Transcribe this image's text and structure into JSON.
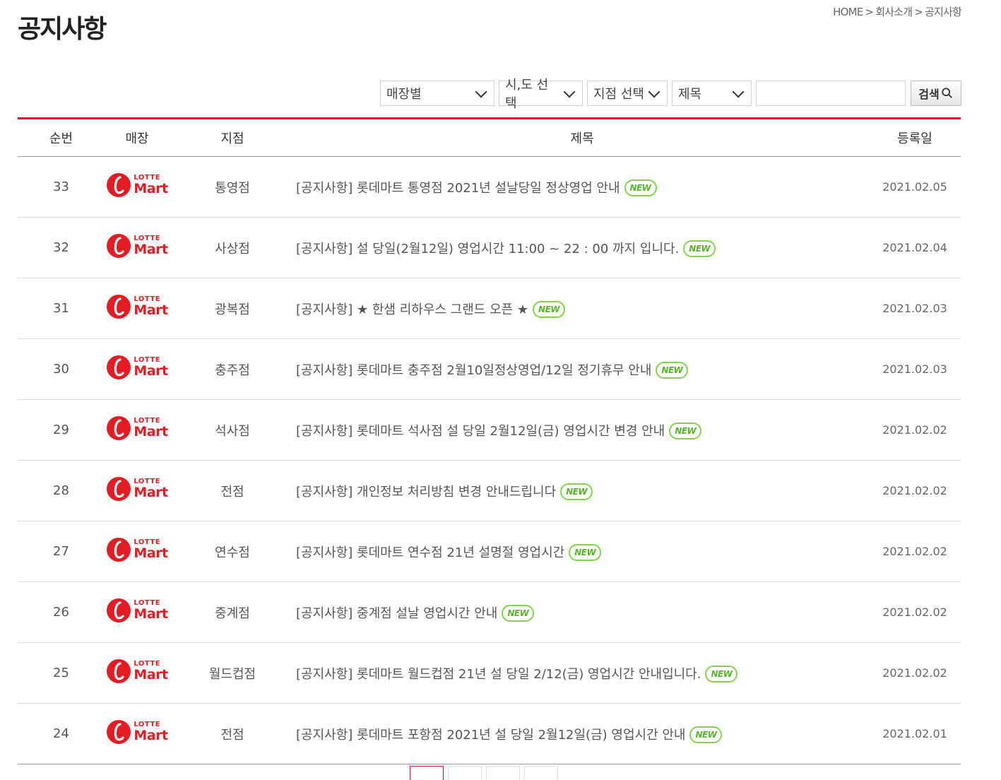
{
  "page": {
    "title": "공지사항",
    "breadcrumb": [
      "HOME",
      "회사소개",
      "공지사항"
    ],
    "breadcrumb_sep": ">"
  },
  "search": {
    "store_type": "매장별",
    "region": "시,도 선택",
    "branch": "지점 선택",
    "field": "제목",
    "query": "",
    "button": "검색"
  },
  "table": {
    "headers": {
      "no": "순번",
      "store": "매장",
      "branch": "지점",
      "subject": "제목",
      "date": "등록일"
    },
    "new_label": "NEW",
    "logo": {
      "top": "LOTTE",
      "bottom": "Mart",
      "color": "#e41b23"
    },
    "rows": [
      {
        "no": "33",
        "branch": "통영점",
        "subject": "[공지사항] 롯데마트 통영점 2021년 설날당일 정상영업 안내",
        "date": "2021.02.05"
      },
      {
        "no": "32",
        "branch": "사상점",
        "subject": "[공지사항] 설 당일(2월12일) 영업시간 11:00 ~ 22 : 00 까지 입니다.",
        "date": "2021.02.04"
      },
      {
        "no": "31",
        "branch": "광복점",
        "subject": "[공지사항] ★ 한샘 리하우스 그랜드 오픈 ★",
        "date": "2021.02.03"
      },
      {
        "no": "30",
        "branch": "충주점",
        "subject": "[공지사항] 롯데마트 충주점 2월10일정상영업/12일 정기휴무 안내",
        "date": "2021.02.03"
      },
      {
        "no": "29",
        "branch": "석사점",
        "subject": "[공지사항] 롯데마트 석사점 설 당일 2월12일(금) 영업시간 변경 안내",
        "date": "2021.02.02"
      },
      {
        "no": "28",
        "branch": "전점",
        "subject": "[공지사항] 개인정보 처리방침 변경 안내드립니다",
        "date": "2021.02.02"
      },
      {
        "no": "27",
        "branch": "연수점",
        "subject": "[공지사항] 롯데마트 연수점 21년 설명절 영업시간",
        "date": "2021.02.02"
      },
      {
        "no": "26",
        "branch": "중계점",
        "subject": "[공지사항] 중계점 설날 영업시간 안내",
        "date": "2021.02.02"
      },
      {
        "no": "25",
        "branch": "월드컵점",
        "subject": "[공지사항] 롯데마트 월드컵점 21년 설 당일 2/12(금) 영업시간 안내입니다.",
        "date": "2021.02.02"
      },
      {
        "no": "24",
        "branch": "전점",
        "subject": "[공지사항] 롯데마트 포항점 2021년 설 당일 2월12일(금) 영업시간 안내",
        "date": "2021.02.01"
      }
    ]
  },
  "colors": {
    "accent": "#d9182a",
    "new_badge": "#7fd44a"
  }
}
